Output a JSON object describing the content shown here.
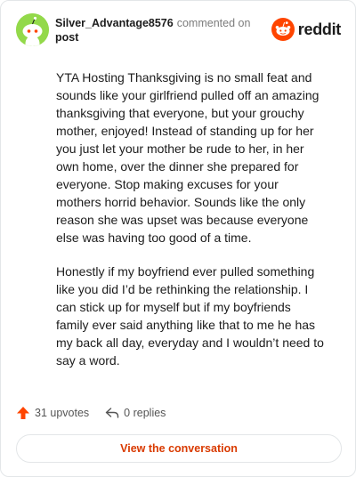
{
  "header": {
    "author": "Silver_Advantage8576",
    "action": "commented on",
    "target": "post",
    "brand": "reddit"
  },
  "comment": {
    "paragraphs": [
      "YTA Hosting Thanksgiving is no small feat and sounds like your girlfriend pulled off an amazing thanksgiving that everyone, but your grouchy mother, enjoyed! Instead of standing up for her you just let your mother be rude to her, in her own home, over the dinner she prepared for everyone. Stop making excuses for your mothers horrid behavior. Sounds like the only reason she was upset was because everyone else was having too good of a time.",
      "Honestly if my boyfriend ever pulled something like you did I’d be rethinking the relationship. I can stick up for myself but if my boyfriends family ever said anything like that to me he has my back all day, everyday and I wouldn’t need to say a word."
    ]
  },
  "footer": {
    "upvotes": "31 upvotes",
    "replies": "0 replies",
    "view_button": "View the conversation"
  },
  "icons": {
    "upvote": "upvote-arrow-icon",
    "reply": "reply-icon",
    "brand": "reddit-snoo-icon"
  },
  "colors": {
    "accent": "#d93a00",
    "upvote": "#ff4500",
    "avatar_bg": "#93d94a",
    "muted": "#7c7c7c"
  }
}
